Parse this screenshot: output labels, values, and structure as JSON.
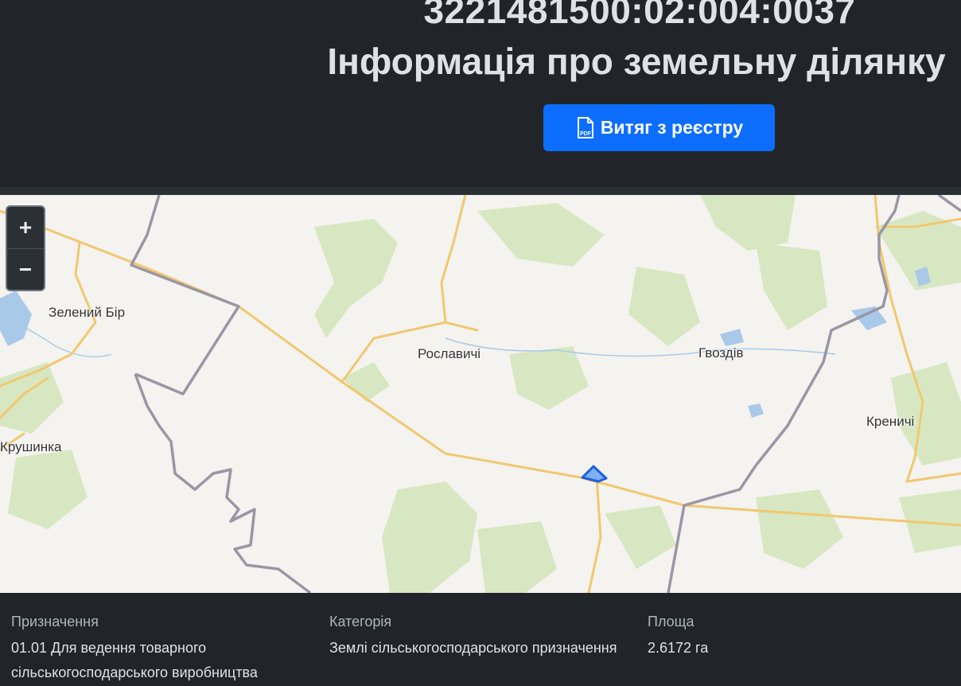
{
  "header": {
    "cadastral_number": "3221481500:02:004:0037",
    "title": "Інформація про земельну ділянку",
    "extract_button": "Витяг з реєстру",
    "pdf_icon_text": "PDF"
  },
  "map": {
    "zoom_in": "+",
    "zoom_out": "−",
    "places": {
      "zeleny_bir": "Зелений Бір",
      "roslavychi": "Рославичі",
      "hvozdiv": "Гвоздів",
      "krenychi": "Креничі",
      "krushynka": "Крушинка"
    },
    "colors": {
      "background": "#f5f3ef",
      "forest": "#cfe3b8",
      "water": "#a9c9e8",
      "road": "#f0c870",
      "border": "#9a96a6",
      "parcel": "#3b82f6"
    }
  },
  "info": {
    "purpose": {
      "label": "Призначення",
      "value": "01.01 Для ведення товарного сільськогосподарського виробництва"
    },
    "category": {
      "label": "Категорія",
      "value": "Землі сільськогосподарського призначення"
    },
    "area": {
      "label": "Площа",
      "value": "2.6172 га"
    }
  }
}
